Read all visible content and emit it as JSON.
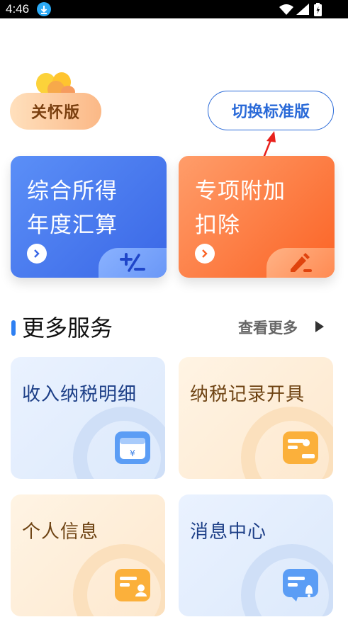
{
  "status_bar": {
    "time": "4:46"
  },
  "care_mode": {
    "label": "关怀版"
  },
  "switch_button": {
    "label": "切换标准版"
  },
  "feature_cards": [
    {
      "line1": "综合所得",
      "line2": "年度汇算",
      "color": "#3a67e6",
      "icon": "plus-minus-icon"
    },
    {
      "line1": "专项附加",
      "line2": "扣除",
      "color": "#fb6325",
      "icon": "pen-icon"
    }
  ],
  "more_services": {
    "title": "更多服务",
    "more_label": "查看更多",
    "items": [
      {
        "label": "收入纳税明细",
        "theme": "blue",
        "icon": "wallet-yen-icon"
      },
      {
        "label": "纳税记录开具",
        "theme": "orange",
        "icon": "stamp-card-icon"
      },
      {
        "label": "个人信息",
        "theme": "orange",
        "icon": "id-card-icon"
      },
      {
        "label": "消息中心",
        "theme": "blue",
        "icon": "message-bell-icon"
      }
    ]
  },
  "colors": {
    "accent": "#2a6ad8",
    "annotation_arrow": "#e8211c"
  }
}
